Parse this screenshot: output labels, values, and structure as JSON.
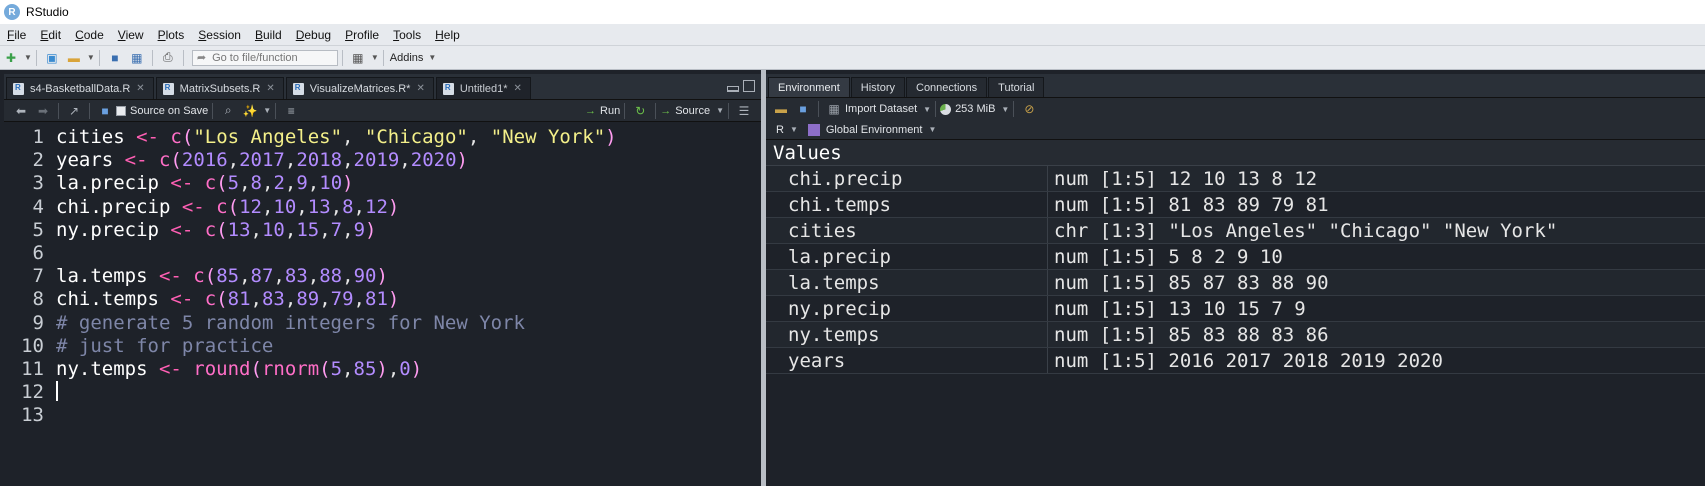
{
  "window": {
    "title": "RStudio",
    "logo_letter": "R"
  },
  "menu": [
    "File",
    "Edit",
    "Code",
    "View",
    "Plots",
    "Session",
    "Build",
    "Debug",
    "Profile",
    "Tools",
    "Help"
  ],
  "toolbar": {
    "goto_placeholder": "Go to file/function",
    "addins": "Addins"
  },
  "editor": {
    "tabs": [
      {
        "label": "s4-BasketballData.R",
        "active": false
      },
      {
        "label": "MatrixSubsets.R",
        "active": false
      },
      {
        "label": "VisualizeMatrices.R*",
        "active": false
      },
      {
        "label": "Untitled1*",
        "active": true
      }
    ],
    "source_on_save": "Source on Save",
    "run": "Run",
    "source": "Source",
    "line_numbers": [
      "1",
      "2",
      "3",
      "4",
      "5",
      "6",
      "7",
      "8",
      "9",
      "10",
      "11",
      "12",
      "13"
    ]
  },
  "code": {
    "l1": [
      "cities",
      " <- ",
      "c",
      "(",
      "\"Los Angeles\"",
      ", ",
      "\"Chicago\"",
      ", ",
      "\"New York\"",
      ")"
    ],
    "l2": [
      "years",
      " <- ",
      "c",
      "(",
      "2016",
      ",",
      "2017",
      ",",
      "2018",
      ",",
      "2019",
      ",",
      "2020",
      ")"
    ],
    "l3": [
      "la.precip",
      " <- ",
      "c",
      "(",
      "5",
      ",",
      "8",
      ",",
      "2",
      ",",
      "9",
      ",",
      "10",
      ")"
    ],
    "l4": [
      "chi.precip",
      " <- ",
      "c",
      "(",
      "12",
      ",",
      "10",
      ",",
      "13",
      ",",
      "8",
      ",",
      "12",
      ")"
    ],
    "l5": [
      "ny.precip",
      " <- ",
      "c",
      "(",
      "13",
      ",",
      "10",
      ",",
      "15",
      ",",
      "7",
      ",",
      "9",
      ")"
    ],
    "l7": [
      "la.temps",
      " <- ",
      "c",
      "(",
      "85",
      ",",
      "87",
      ",",
      "83",
      ",",
      "88",
      ",",
      "90",
      ")"
    ],
    "l8": [
      "chi.temps",
      " <- ",
      "c",
      "(",
      "81",
      ",",
      "83",
      ",",
      "89",
      ",",
      "79",
      ",",
      "81",
      ")"
    ],
    "l9": "# generate 5 random integers for New York",
    "l10": "# just for practice",
    "l11": [
      "ny.temps",
      " <- ",
      "round",
      "(",
      "rnorm",
      "(",
      "5",
      ",",
      "85",
      ")",
      ",",
      "0",
      ")"
    ]
  },
  "environment": {
    "tabs": [
      {
        "label": "Environment",
        "active": true
      },
      {
        "label": "History",
        "active": false
      },
      {
        "label": "Connections",
        "active": false
      },
      {
        "label": "Tutorial",
        "active": false
      }
    ],
    "import_dataset": "Import Dataset",
    "memory": "253 MiB",
    "lang": "R",
    "scope": "Global Environment",
    "section": "Values",
    "rows": [
      {
        "name": "chi.precip",
        "value": "num [1:5] 12 10 13 8 12"
      },
      {
        "name": "chi.temps",
        "value": "num [1:5] 81 83 89 79 81"
      },
      {
        "name": "cities",
        "value": "chr [1:3] \"Los Angeles\" \"Chicago\" \"New York\""
      },
      {
        "name": "la.precip",
        "value": "num [1:5] 5 8 2 9 10"
      },
      {
        "name": "la.temps",
        "value": "num [1:5] 85 87 83 88 90"
      },
      {
        "name": "ny.precip",
        "value": "num [1:5] 13 10 15 7 9"
      },
      {
        "name": "ny.temps",
        "value": "num [1:5] 85 83 88 83 86"
      },
      {
        "name": "years",
        "value": "num [1:5] 2016 2017 2018 2019 2020"
      }
    ]
  }
}
